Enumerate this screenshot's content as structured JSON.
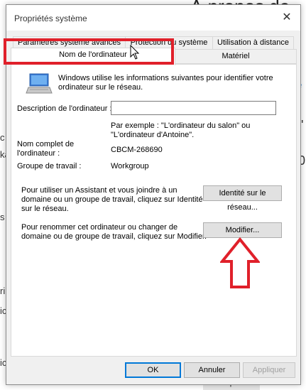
{
  "background": {
    "title": "À propos de",
    "left_chars": [
      "c",
      "ka",
      "s",
      "ri",
      "ic",
      "ic"
    ],
    "right_chars": [
      "l'",
      "0"
    ],
    "link": "e",
    "bottom_button": "Copier"
  },
  "dialog": {
    "title": "Propriétés système",
    "tabs_row1": [
      "Paramètres système avancés",
      "Protection du système",
      "Utilisation à distance"
    ],
    "tabs_row2": [
      "Nom de l'ordinateur",
      "Matériel"
    ],
    "intro_line1": "Windows utilise les informations suivantes pour identifier votre",
    "intro_line2": "ordinateur sur le réseau.",
    "description_label": "Description de l'ordinateur :",
    "description_value": "",
    "example_line1": "Par exemple : \"L'ordinateur du salon\" ou",
    "example_line2": "\"L'ordinateur d'Antoine\".",
    "fullname_label_line1": "Nom complet de",
    "fullname_label_line2": "l'ordinateur :",
    "fullname_value": "CBCM-268690",
    "workgroup_label": "Groupe de travail :",
    "workgroup_value": "Workgroup",
    "network_text_line1": "Pour utiliser un Assistant et vous joindre à un",
    "network_text_line2": "domaine ou un groupe de travail, cliquez sur Identité",
    "network_text_line3": "sur le réseau.",
    "network_id_button": "Identité sur le réseau...",
    "rename_text_line1": "Pour renommer cet ordinateur ou changer de",
    "rename_text_line2": "domaine ou de groupe de travail, cliquez sur Modifier.",
    "modify_button": "Modifier...",
    "ok_button": "OK",
    "cancel_button": "Annuler",
    "apply_button": "Appliquer"
  },
  "colors": {
    "highlight": "#e0202a",
    "accent": "#0078d7"
  },
  "icons": [
    "close-icon",
    "computer-icon",
    "cursor-icon",
    "up-arrow-icon"
  ]
}
